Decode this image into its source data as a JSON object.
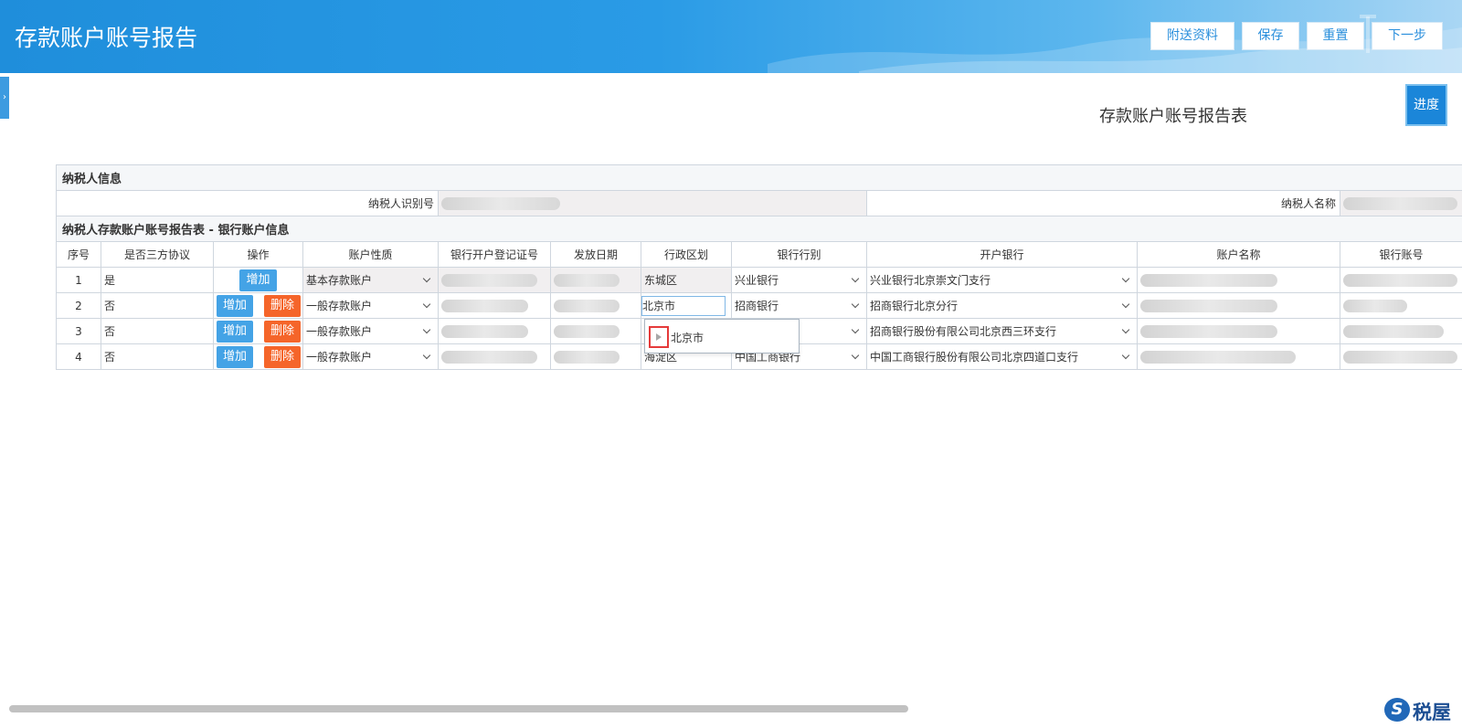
{
  "header": {
    "title": "存款账户账号报告",
    "buttons": [
      "附送资料",
      "保存",
      "重置",
      "下一步"
    ]
  },
  "progress_label": "进度",
  "form_title": "存款账户账号报告表",
  "taxpayer": {
    "section_label": "纳税人信息",
    "id_label": "纳税人识别号",
    "name_label": "纳税人名称"
  },
  "bank": {
    "section_label": "纳税人存款账户账号报告表 - 银行账户信息",
    "columns": [
      "序号",
      "是否三方协议",
      "操作",
      "账户性质",
      "银行开户登记证号",
      "发放日期",
      "行政区划",
      "银行行别",
      "开户银行",
      "账户名称",
      "银行账号"
    ],
    "add_label": "增加",
    "delete_label": "删除",
    "rows": [
      {
        "no": "1",
        "tripartite": "是",
        "account_type": "基本存款账户",
        "district": "东城区",
        "bank_type": "兴业银行",
        "branch": "兴业银行北京崇文门支行"
      },
      {
        "no": "2",
        "tripartite": "否",
        "account_type": "一般存款账户",
        "district": "北京市",
        "bank_type": "招商银行",
        "branch": "招商银行北京分行"
      },
      {
        "no": "3",
        "tripartite": "否",
        "account_type": "一般存款账户",
        "district": "",
        "bank_type": "",
        "branch": "招商银行股份有限公司北京西三环支行"
      },
      {
        "no": "4",
        "tripartite": "否",
        "account_type": "一般存款账户",
        "district": "海淀区",
        "bank_type": "中国工商银行",
        "branch": "中国工商银行股份有限公司北京四道口支行"
      }
    ]
  },
  "district_popup": {
    "item": "北京市"
  },
  "logo_text": "税屋",
  "logo_mark": "S",
  "side_tab_glyph": "›",
  "colors": {
    "header": "#2a9be6",
    "add": "#44a3e6",
    "delete": "#f5652a",
    "progress": "#1b86d9"
  }
}
